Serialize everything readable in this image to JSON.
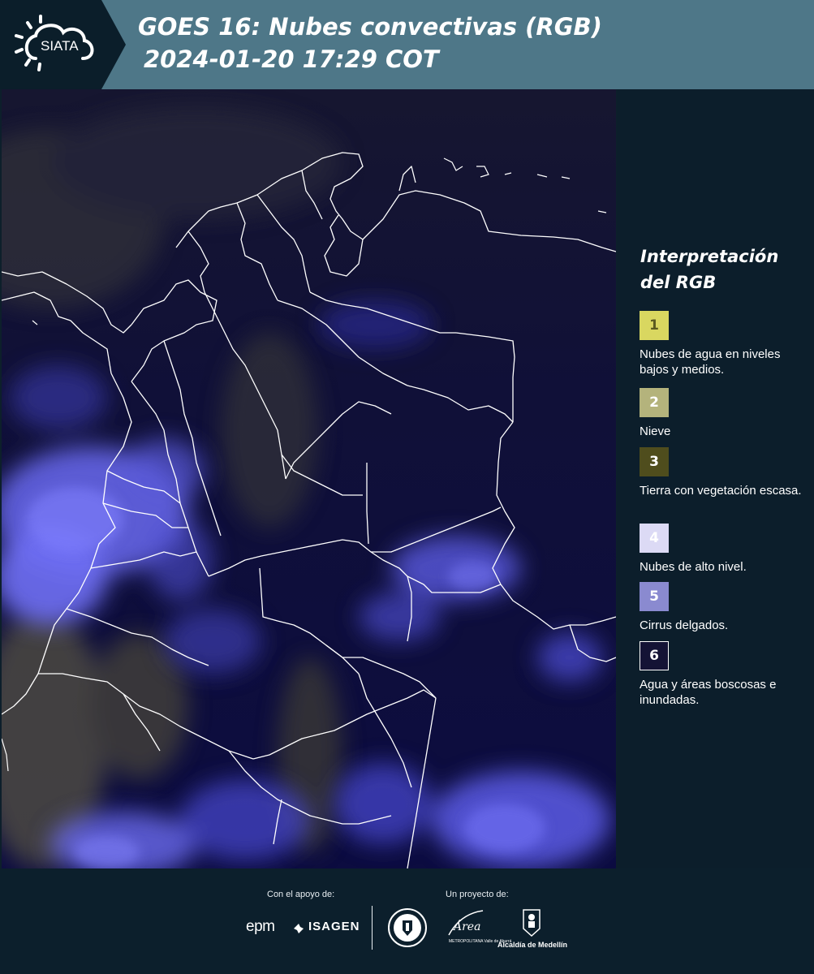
{
  "header": {
    "logo_text": "SIATA",
    "title_line1": "GOES 16: Nubes convectivas (RGB)",
    "title_line2": "2024-01-20 17:29 COT"
  },
  "legend": {
    "title": "Interpretación del RGB",
    "items": [
      {
        "number": "1",
        "label": "Nubes de agua en niveles bajos y medios.",
        "color": "#d9d760",
        "text_color": "#5a5a20"
      },
      {
        "number": "2",
        "label": "Nieve",
        "color": "#b4b37c",
        "text_color": "#ffffff"
      },
      {
        "number": "3",
        "label": "Tierra con vegetación escasa.",
        "color": "#4f4d1d",
        "text_color": "#ffffff"
      },
      {
        "number": "4",
        "label": "Nubes de alto nivel.",
        "color": "#dcdaf5",
        "text_color": "#ffffff"
      },
      {
        "number": "5",
        "label": "Cirrus delgados.",
        "color": "#8a8ad0",
        "text_color": "#ffffff"
      },
      {
        "number": "6",
        "label": "Agua y áreas boscosas e inundadas.",
        "color": "#141335",
        "text_color": "#ffffff"
      }
    ]
  },
  "footer": {
    "support_label": "Con el apoyo de:",
    "project_label": "Un proyecto de:",
    "sponsor_epm": "epm",
    "sponsor_isagen": "ISAGEN",
    "area_logo_text": "Área",
    "area_caption": "METROPOLITANA Valle de Aburrá",
    "alcaldia_label": "Alcaldía de Medellín"
  },
  "colors": {
    "header_bg": "#4e7788",
    "logo_bg": "#0b1e2a",
    "page_bg": "#0c1e2b",
    "map_bg": "#0e0f33",
    "cloud_blue": "#5a5ae6",
    "land_tan": "#8c8458"
  }
}
